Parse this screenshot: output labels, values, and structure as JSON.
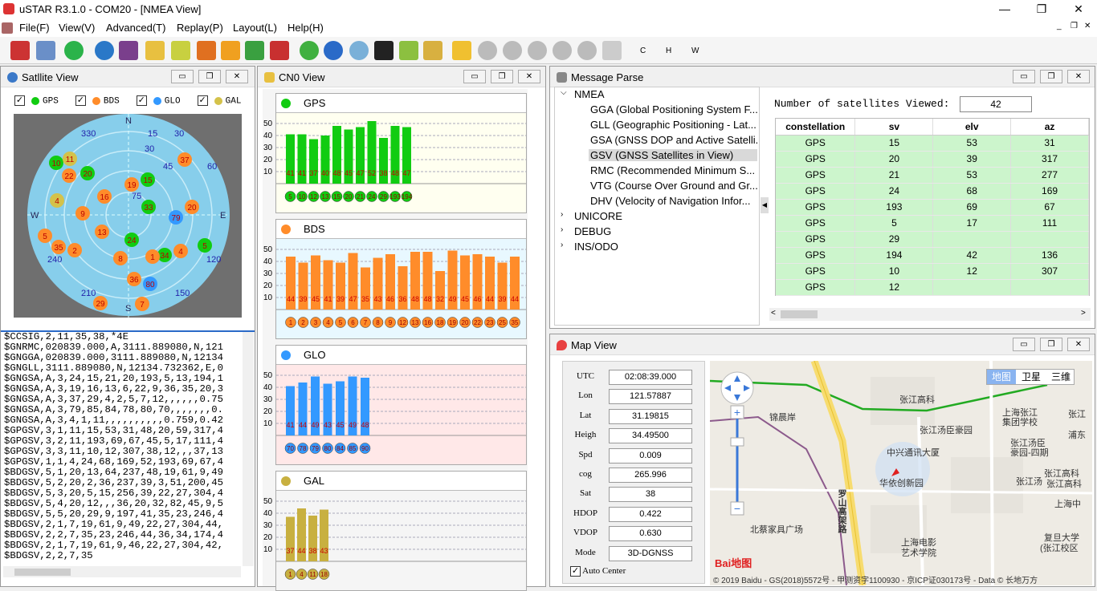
{
  "window": {
    "title": "uSTAR  R3.1.0 - COM20 - [NMEA View]",
    "minimize": "—",
    "maximize": "❐",
    "close": "✕"
  },
  "menu": [
    "File(F)",
    "View(V)",
    "Advanced(T)",
    "Replay(P)",
    "Layout(L)",
    "Help(H)"
  ],
  "toolbar": {
    "icons": [
      "disconnect-icon",
      "save-icon",
      "refresh-icon",
      "network-icon",
      "folder-icon",
      "chart-icon",
      "list-icon",
      "location-icon",
      "settings-icon",
      "spreadsheet-icon",
      "tools-icon",
      "download-icon",
      "globe-icon",
      "clock-icon",
      "monitor-icon",
      "d-icon",
      "brush-icon",
      "open-icon",
      "play-icon",
      "rewind-icon",
      "pause-icon",
      "forward-icon",
      "stop-icon",
      "next-icon"
    ],
    "letters": [
      "C",
      "H",
      "W"
    ]
  },
  "sat_view": {
    "title": "Satllite View",
    "legend": [
      {
        "name": "GPS",
        "color": "#11cc11"
      },
      {
        "name": "BDS",
        "color": "#ff8c2a"
      },
      {
        "name": "GLO",
        "color": "#3399ff"
      },
      {
        "name": "GAL",
        "color": "#d4c24a"
      }
    ],
    "compass": {
      "n": "N",
      "s": "S",
      "e": "E",
      "w": "W"
    },
    "az_labels": [
      "330",
      "15",
      "30",
      "30",
      "45",
      "60",
      "75",
      "90",
      "105",
      "120",
      "150",
      "210",
      "240",
      "300"
    ]
  },
  "cn0": {
    "title": "CN0 View",
    "y_ticks": [
      "50",
      "40",
      "30",
      "20",
      "10"
    ],
    "sections": [
      {
        "name": "GPS",
        "color": "#11cc11",
        "bg": "#fffff0",
        "values": [
          41,
          41,
          37,
          40,
          48,
          45,
          47,
          52,
          38,
          48,
          47
        ],
        "prns": [
          "5",
          "10",
          "12",
          "13",
          "15",
          "20",
          "21",
          "24",
          "29",
          "193",
          "194"
        ],
        "value_labels": [
          "41",
          "41",
          "37",
          "40",
          "48",
          "45",
          "47",
          "52",
          "38",
          "48",
          "47"
        ]
      },
      {
        "name": "BDS",
        "color": "#ff8c2a",
        "bg": "#e8f8ff",
        "values": [
          44,
          39,
          45,
          41,
          39,
          47,
          35,
          43,
          46,
          36,
          48,
          48,
          32,
          49,
          45,
          46,
          44,
          39,
          44
        ],
        "prns": [
          "1",
          "2",
          "3",
          "4",
          "5",
          "6",
          "7",
          "8",
          "9",
          "12",
          "13",
          "16",
          "18",
          "19",
          "20",
          "22",
          "23",
          "25",
          "35"
        ],
        "value_labels": [
          "44",
          "39",
          "45",
          "41",
          "39",
          "47",
          "35",
          "43",
          "46",
          "36",
          "48",
          "48",
          "32",
          "49",
          "45",
          "46",
          "44",
          "39",
          "44"
        ]
      },
      {
        "name": "GLO",
        "color": "#3399ff",
        "bg": "#ffe8e8",
        "values": [
          41,
          44,
          49,
          43,
          45,
          49,
          48
        ],
        "prns": [
          "70",
          "78",
          "79",
          "80",
          "84",
          "85",
          "90"
        ],
        "value_labels": [
          "41",
          "44",
          "49",
          "43",
          "45",
          "49",
          "48"
        ]
      },
      {
        "name": "GAL",
        "color": "#c8b040",
        "bg": "#f5f5f5",
        "values": [
          37,
          44,
          38,
          43
        ],
        "prns": [
          "1",
          "4",
          "11",
          "18"
        ],
        "value_labels": [
          "37",
          "44",
          "38",
          "43"
        ]
      }
    ]
  },
  "nmea_lines": [
    "$CCSIG,2,11,35,38,*4E",
    "$GNRMC,020839.000,A,3111.889080,N,121",
    "$GNGGA,020839.000,3111.889080,N,12134",
    "$GNGLL,3111.889080,N,12134.732362,E,0",
    "$GNGSA,A,3,24,15,21,20,193,5,13,194,1",
    "$GNGSA,A,3,19,16,13,6,22,9,36,35,20,3",
    "$GNGSA,A,3,37,29,4,2,5,7,12,,,,,,0.75",
    "$GNGSA,A,3,79,85,84,78,80,70,,,,,,,0.",
    "$GNGSA,A,3,4,1,11,,,,,,,,,,0.759,0.42",
    "$GPGSV,3,1,11,15,53,31,48,20,59,317,4",
    "$GPGSV,3,2,11,193,69,67,45,5,17,111,4",
    "$GPGSV,3,3,11,10,12,307,38,12,,,37,13",
    "$GPGSV,1,1,4,24,68,169,52,193,69,67,4",
    "$BDGSV,5,1,20,13,64,237,48,19,61,9,49",
    "$BDGSV,5,2,20,2,36,237,39,3,51,200,45",
    "$BDGSV,5,3,20,5,15,256,39,22,27,304,4",
    "$BDGSV,5,4,20,12,,,36,20,32,82,45,9,5",
    "$BDGSV,5,5,20,29,9,197,41,35,23,246,4",
    "$BDGSV,2,1,7,19,61,9,49,22,27,304,44,",
    "$BDGSV,2,2,7,35,23,246,44,36,34,174,4",
    "$BDGSV,2,1,7,19,61,9,46,22,27,304,42,",
    "$BDGSV,2,2,7,35"
  ],
  "msg_parse": {
    "title": "Message Parse",
    "tree": [
      {
        "label": "NMEA",
        "open": true,
        "children": [
          "GGA (Global Positioning System F...",
          "GLL (Geographic Positioning - Lat...",
          "GSA (GNSS DOP and Active Satelli...",
          "GSV (GNSS Satellites in View)",
          "RMC (Recommended Minimum S...",
          "VTG (Course Over Ground and Gr...",
          "DHV (Velocity of Navigation Infor..."
        ]
      },
      {
        "label": "UNICORE"
      },
      {
        "label": "DEBUG"
      },
      {
        "label": "INS/ODO"
      }
    ],
    "selected": "GSV (GNSS Satellites in View)",
    "sats_viewed_label": "Number of satellites Viewed:",
    "sats_viewed": "42",
    "columns": [
      "constellation",
      "sv",
      "elv",
      "az"
    ],
    "rows": [
      [
        "GPS",
        "15",
        "53",
        "31"
      ],
      [
        "GPS",
        "20",
        "39",
        "317"
      ],
      [
        "GPS",
        "21",
        "53",
        "277"
      ],
      [
        "GPS",
        "24",
        "68",
        "169"
      ],
      [
        "GPS",
        "193",
        "69",
        "67"
      ],
      [
        "GPS",
        "5",
        "17",
        "111"
      ],
      [
        "GPS",
        "29",
        "",
        ""
      ],
      [
        "GPS",
        "194",
        "42",
        "136"
      ],
      [
        "GPS",
        "10",
        "12",
        "307"
      ],
      [
        "GPS",
        "12",
        "",
        ""
      ]
    ]
  },
  "map_view": {
    "title": "Map View",
    "fields": [
      {
        "label": "UTC",
        "value": "02:08:39.000"
      },
      {
        "label": "Lon",
        "value": "121.57887"
      },
      {
        "label": "Lat",
        "value": "31.19815"
      },
      {
        "label": "Heigh",
        "value": "34.49500"
      },
      {
        "label": "Spd",
        "value": "0.009"
      },
      {
        "label": "cog",
        "value": "265.996"
      },
      {
        "label": "Sat",
        "value": "38"
      },
      {
        "label": "HDOP",
        "value": "0.422"
      },
      {
        "label": "VDOP",
        "value": "0.630"
      },
      {
        "label": "Mode",
        "value": "3D-DGNSS"
      }
    ],
    "auto_center": "Auto Center",
    "map_types": [
      "地图",
      "卫星",
      "三维"
    ],
    "places": [
      "张江高科",
      "上海张江",
      "集团学校",
      "张江汤臣豪园",
      "中兴通讯大厦",
      "张江汤臣",
      "豪园-四期",
      "张江高科",
      "张江高科",
      "华依创新园",
      "北蔡家具广场",
      "上海电影",
      "艺术学院",
      "复旦大学",
      "(张江校区",
      "上海中",
      "浦东",
      "张江",
      "张江汤",
      "罗山高架路",
      "锦晨岸"
    ],
    "copyright": "© 2019 Baidu - GS(2018)5572号 - 甲测资字1100930 - 京ICP证030173号 - Data © 长地万方",
    "baidu": "Bai地图"
  }
}
